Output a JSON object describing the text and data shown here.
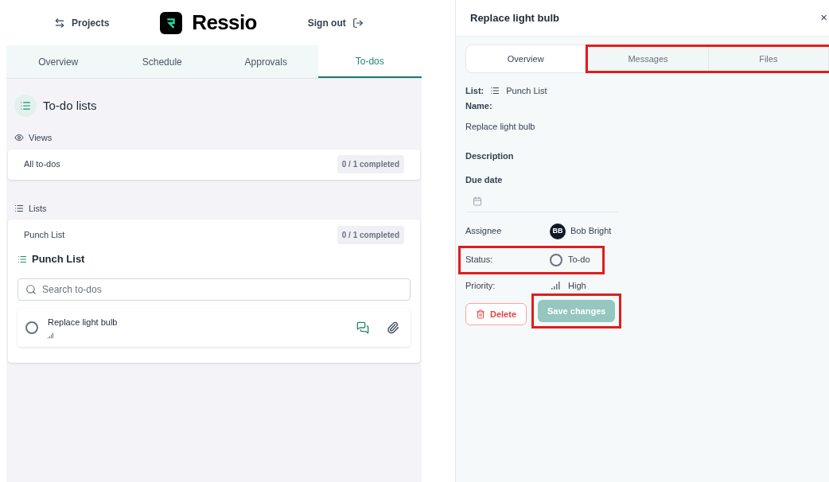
{
  "header": {
    "projects_link": "Projects",
    "logo_text": "Ressio",
    "sign_out": "Sign out"
  },
  "nav_tabs": [
    {
      "label": "Overview",
      "selected": false
    },
    {
      "label": "Schedule",
      "selected": false
    },
    {
      "label": "Approvals",
      "selected": false
    },
    {
      "label": "To-dos",
      "selected": true
    }
  ],
  "page_title": "To-do lists",
  "views": {
    "heading": "Views",
    "items": [
      {
        "name": "All to-dos",
        "count": "0 / 1 completed"
      }
    ]
  },
  "lists": {
    "heading": "Lists",
    "items": [
      {
        "name": "Punch List",
        "count": "0 / 1 completed"
      }
    ]
  },
  "open_list": {
    "title": "Punch List",
    "search": {
      "placeholder": "Search to-dos"
    },
    "todos": [
      {
        "title": "Replace light bulb",
        "checked": false
      }
    ]
  },
  "detail": {
    "title": "Replace light bulb",
    "close": "×",
    "tabs": [
      {
        "label": "Overview",
        "selected": true,
        "highlighted": false
      },
      {
        "label": "Messages",
        "selected": false,
        "highlighted": true
      },
      {
        "label": "Files",
        "selected": false,
        "highlighted": true
      }
    ],
    "list_label": "List:",
    "list_value": "Punch List",
    "name_label": "Name:",
    "name_value": "Replace light bulb",
    "description_label": "Description",
    "due_date_label": "Due date",
    "assignee_label": "Assignee",
    "assignee_initials": "BB",
    "assignee_name": "Bob Bright",
    "status": {
      "label": "Status:",
      "value": "To-do",
      "checked": false,
      "highlighted": true
    },
    "priority_label": "Priority:",
    "priority_value": "High",
    "delete_button": "Delete",
    "save_button": {
      "label": "Save changes",
      "disabled": true,
      "highlighted": true
    }
  }
}
